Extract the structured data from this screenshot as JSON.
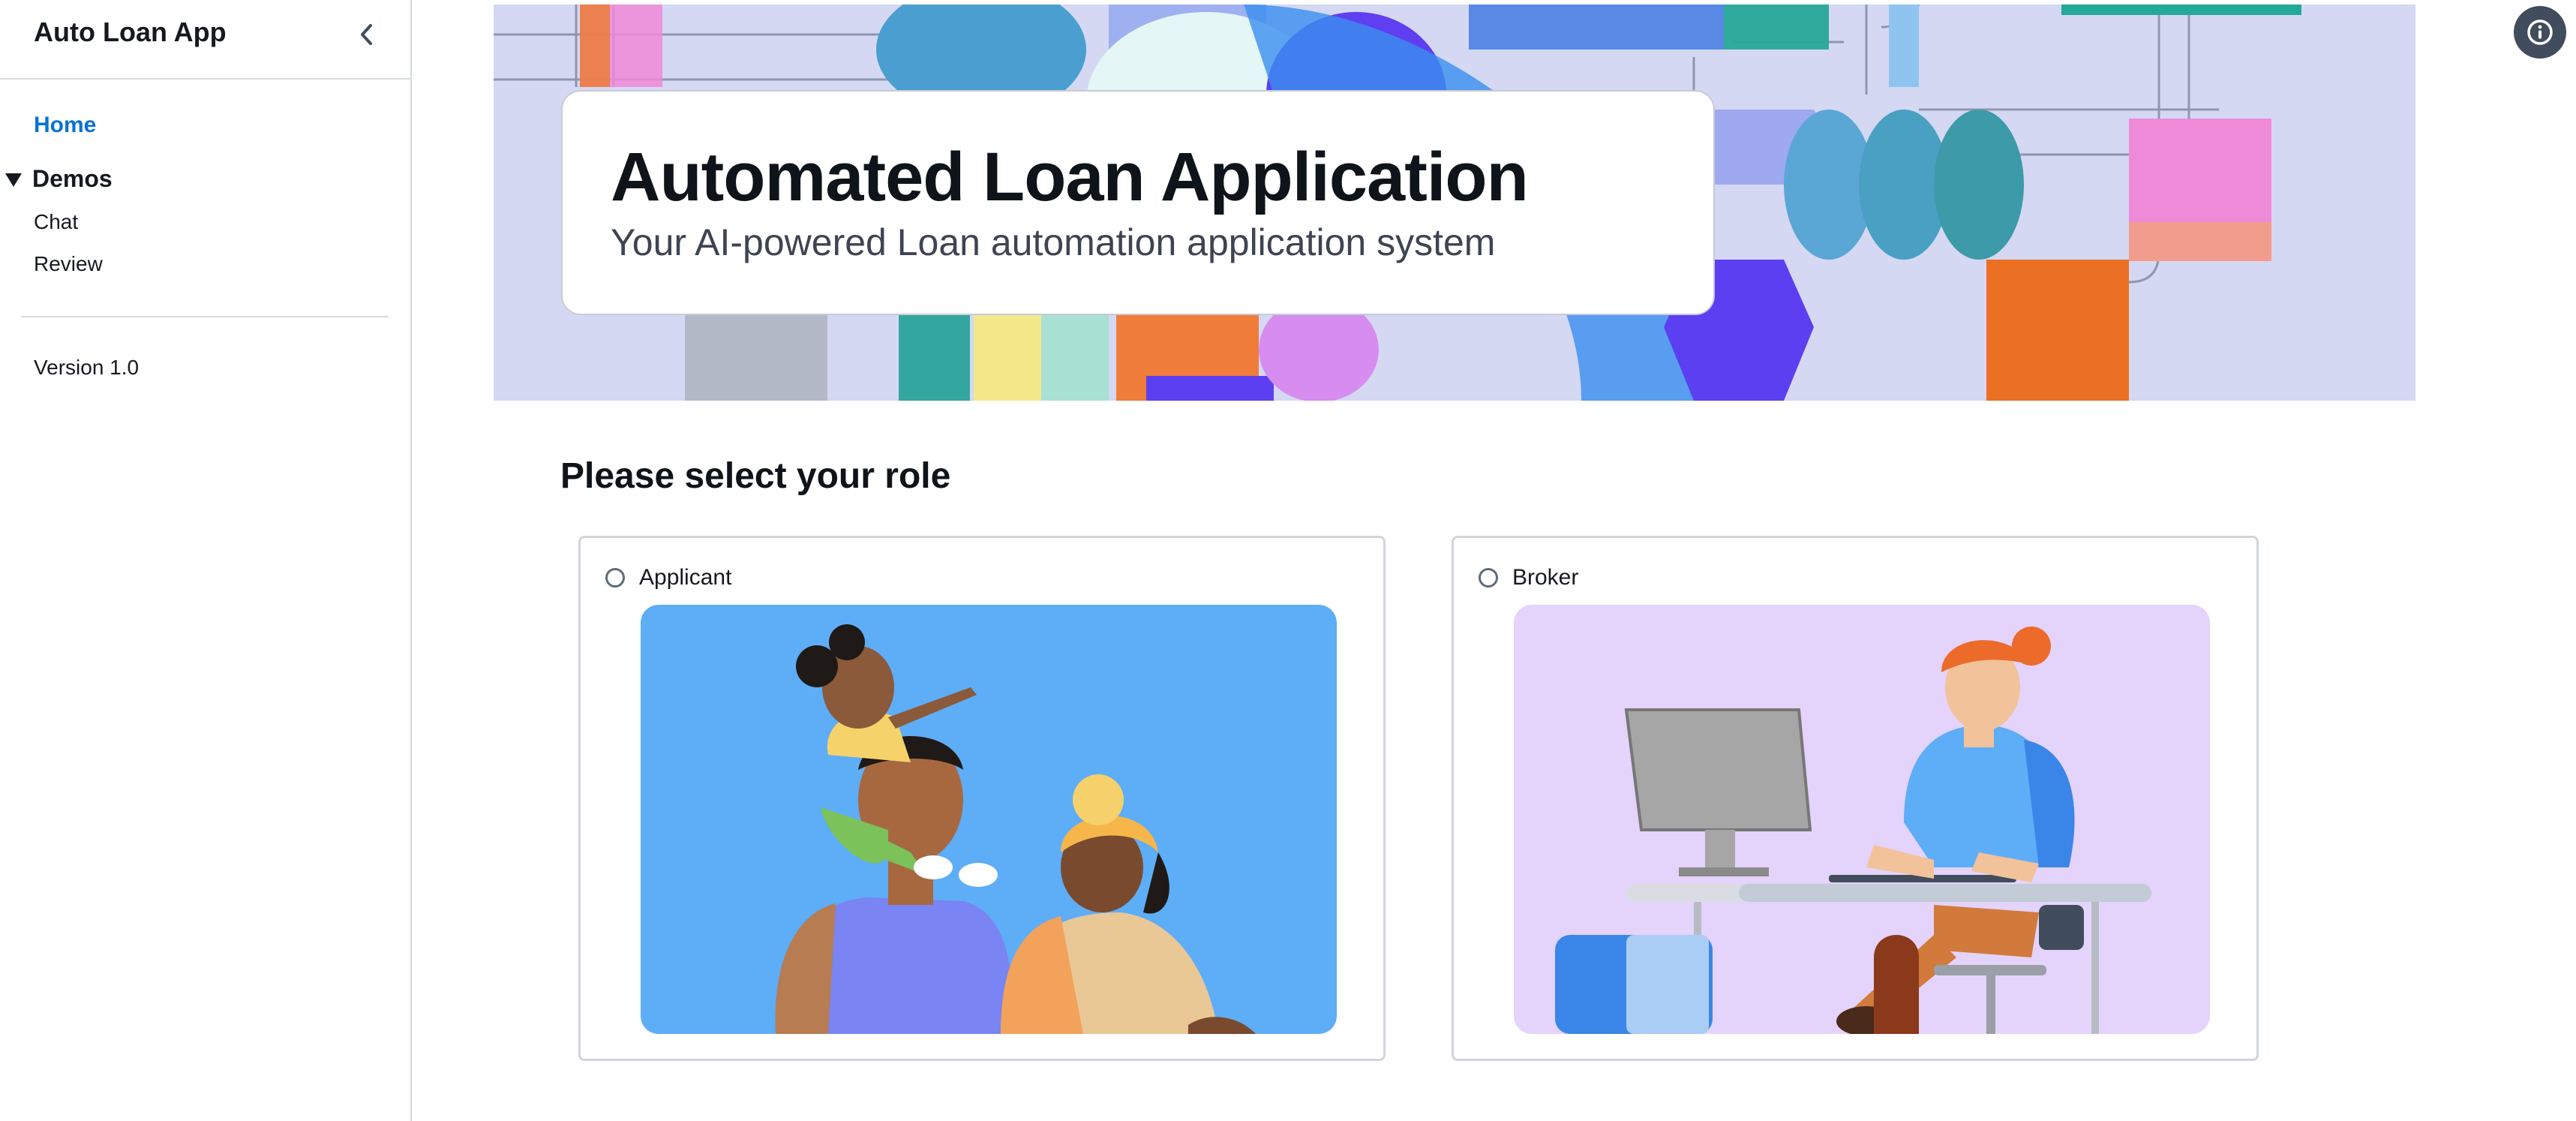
{
  "sidebar": {
    "app_title": "Auto Loan App",
    "nav": {
      "home": "Home",
      "demos": "Demos",
      "chat": "Chat",
      "review": "Review"
    },
    "version": "Version 1.0"
  },
  "hero": {
    "title": "Automated Loan Application",
    "subtitle": "Your AI-powered Loan automation application system"
  },
  "role_section": {
    "title": "Please select your role",
    "options": [
      {
        "label": "Applicant",
        "selected": false
      },
      {
        "label": "Broker",
        "selected": false
      }
    ]
  },
  "colors": {
    "accent": "#0972d3",
    "hero_bg": "#d5d8f3",
    "applicant_illustration_bg": "#5eadf7",
    "broker_illustration_bg": "#e4d3fb"
  },
  "icons": [
    "chevron-left-icon",
    "caret-down-icon",
    "info-icon"
  ]
}
